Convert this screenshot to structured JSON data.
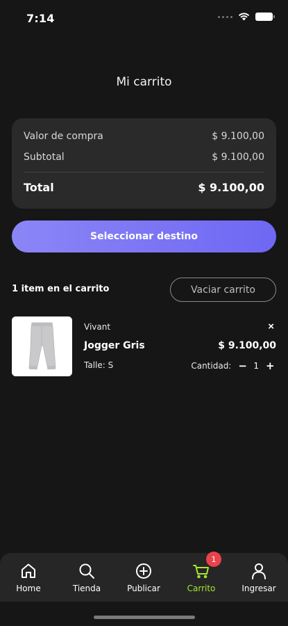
{
  "status_bar": {
    "time": "7:14"
  },
  "header": {
    "title": "Mi carrito"
  },
  "summary": {
    "purchase_label": "Valor de compra",
    "purchase_value": "$ 9.100,00",
    "subtotal_label": "Subtotal",
    "subtotal_value": "$ 9.100,00",
    "total_label": "Total",
    "total_value": "$ 9.100,00"
  },
  "select_destination_label": "Seleccionar destino",
  "cart": {
    "items_count_label": "1 item en el carrito",
    "clear_label": "Vaciar carrito",
    "items": [
      {
        "brand": "Vivant",
        "name": "Jogger Gris",
        "price": "$ 9.100,00",
        "size_label": "Talle: S",
        "quantity_label": "Cantidad:",
        "quantity": "1",
        "remove_icon": "×",
        "minus": "−",
        "plus": "+"
      }
    ]
  },
  "tab_bar": {
    "accent_color": "#a8e632",
    "badge_color": "#e8434b",
    "tabs": [
      {
        "label": "Home",
        "icon": "home-icon"
      },
      {
        "label": "Tienda",
        "icon": "search-icon"
      },
      {
        "label": "Publicar",
        "icon": "plus-circle-icon"
      },
      {
        "label": "Carrito",
        "icon": "cart-icon",
        "active": true,
        "badge": "1"
      },
      {
        "label": "Ingresar",
        "icon": "user-icon"
      }
    ]
  }
}
